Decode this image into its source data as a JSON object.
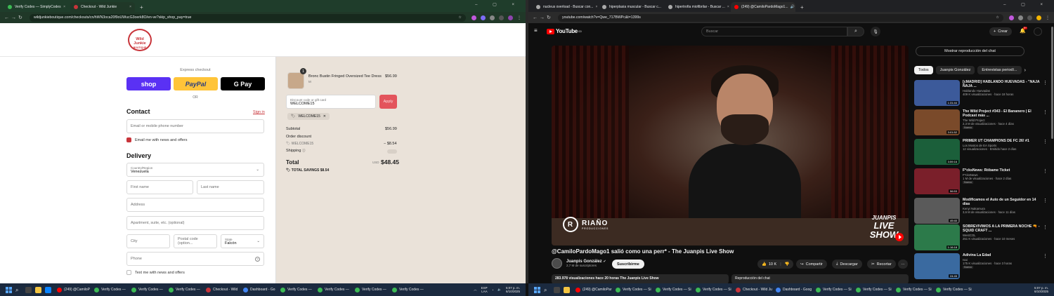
{
  "left_browser": {
    "tabs": [
      {
        "title": "Verify Codes — SimplyCodes",
        "color": "#3cba54",
        "active": false
      },
      {
        "title": "Checkout - Wild Junkie",
        "color": "#c8343a",
        "active": true
      }
    ],
    "url": "wildjunkieboutique.com/checkouts/cn/hWN3oca20f9oUWucG3oerk8O/en-ve?skip_shop_pay=true"
  },
  "checkout": {
    "logo_text": "Wild Junkie",
    "logo_sub": "BOUTIQUE",
    "express_label": "Express checkout",
    "shop_label": "shop",
    "paypal_label": "PayPal",
    "gpay_label": "G Pay",
    "or_label": "OR",
    "contact_heading": "Contact",
    "sign_in": "Sign in",
    "email_placeholder": "Email or mobile phone number",
    "email_news_label": "Email me with news and offers",
    "delivery_heading": "Delivery",
    "country_label": "Country/Region",
    "country_value": "Venezuela",
    "first_name": "First name",
    "last_name": "Last name",
    "address": "Address",
    "apartment": "Apartment, suite, etc. (optional)",
    "city": "City",
    "postal": "Postal code (option...",
    "state_label": "State",
    "state_value": "Falcón",
    "phone": "Phone",
    "text_news_label": "Text me with news and offers"
  },
  "summary": {
    "qty": "1",
    "product_name": "Bronc Bustin Fringed Oversized Tee Dress",
    "variant": "M",
    "product_price": "$56.99",
    "discount_label": "Discount code or gift card",
    "discount_value": "WELCOME15",
    "apply": "Apply",
    "chip_code": "WELCOME15",
    "subtotal_label": "Subtotal",
    "subtotal_value": "$56.99",
    "order_discount_label": "Order discount",
    "discount_code": "WELCOME15",
    "discount_amount": "− $8.54",
    "shipping_label": "Shipping",
    "total_label": "Total",
    "currency": "USD",
    "total_value": "$48.45",
    "savings_label": "TOTAL SAVINGS",
    "savings_value": "$8.54"
  },
  "right_browser": {
    "tabs": [
      {
        "title": "nucleus overload - Buscar con...",
        "color": "#aaaaaa",
        "active": false
      },
      {
        "title": "hiperplasia muscular - Buscar c...",
        "color": "#aaaaaa",
        "active": false
      },
      {
        "title": "hipertrofia miofibrilar - Buscar ...",
        "color": "#aaaaaa",
        "active": false
      },
      {
        "title": "(249) @CamiloPardoMago1...",
        "color": "#ff0000",
        "active": true
      }
    ],
    "url": "youtube.com/watch?v=Qwe_717BWPc&t=1399s"
  },
  "youtube": {
    "logo": "YouTube",
    "region": "CO",
    "search_placeholder": "Buscar",
    "create": "Crear",
    "notif_count": "9+",
    "video_title": "@CamiloPardoMago1 salió como una perr* - The Juanpis Live Show",
    "watermark_left": "RIAÑO",
    "watermark_left_sub": "PRODUCCIONES",
    "watermark_right_top": "JUANPIS",
    "watermark_right_bottom": "LIVE SHOW",
    "channel_name": "Juanpis González",
    "subscribers": "2,7 M de suscriptores",
    "subscribe": "Suscribirme",
    "likes": "10 K",
    "share": "Compartir",
    "download": "Descargar",
    "clip": "Recortar",
    "more": "···",
    "views_meta": "283.978 visualizaciones  hace 20 horas  The Juanpis Live Show",
    "chat_replay": "Reproducción del chat",
    "show_chat": "Mostrar reproducción del chat",
    "chips": [
      "Todos",
      "Juanpis González",
      "Entrevistas periodí..."
    ],
    "recommendations": [
      {
        "title": "[cMADRID] HABLANDO HUEVADAS - \"ÑAJA ÑAJA ...",
        "channel": "Hablando Huevadas",
        "meta": "409 K visualizaciones · hace 18 horas",
        "duration": "1:31:44",
        "new": "",
        "thumb": "#3c5a9a"
      },
      {
        "title": "The Wild Project #343 - El Bananero | El Podcast más ...",
        "channel": "The Wild Project",
        "meta": "2,3 M de visualizaciones · hace 4 días",
        "duration": "3:01:52",
        "new": "Nuevo",
        "thumb": "#7a4a2a"
      },
      {
        "title": "PRIMER UT CHAMPIONS DE FC 26! #1",
        "channel": "Los Mostos de EA Sports",
        "meta": "12 visualizaciones · Emitido hace 2 días",
        "duration": "3:59:16",
        "new": "",
        "thumb": "#1b5f3a"
      },
      {
        "title": "F*cksNews: Róbame Ticket",
        "channel": "F*cksNews",
        "meta": "1 M de visualizaciones · hace 2 días",
        "duration": "56:53",
        "new": "Nuevo",
        "thumb": "#7a1f2a"
      },
      {
        "title": "Modificamos el Auto de un Seguidor en 14 días",
        "channel": "Kenyi Nakamura",
        "meta": "3,6 M de visualizaciones · hace 11 días",
        "duration": "49:40",
        "new": "",
        "thumb": "#5a5a5a"
      },
      {
        "title": "SOBREVIVIMOS A LA PRIMERA NOCHE 🔫 - SQUID CRAFT ...",
        "channel": "WestCOL",
        "meta": "251 K visualizaciones · hace 10 meses",
        "duration": "1:16:18",
        "new": "",
        "thumb": "#2c7a4a"
      },
      {
        "title": "Adivina La Edad",
        "channel": "Isai",
        "meta": "175 K visualizaciones · hace 3 horas",
        "duration": "24:45",
        "new": "Nuevo",
        "thumb": "#3a6aa0"
      }
    ]
  },
  "taskbar_left": {
    "tasks": [
      {
        "label": "(249) @CamiloP",
        "color": "#ff0000"
      },
      {
        "label": "Verify Codes —",
        "color": "#3cba54"
      },
      {
        "label": "Verify Codes —",
        "color": "#3cba54"
      },
      {
        "label": "Verify Codes —",
        "color": "#3cba54"
      },
      {
        "label": "Checkout - Wild",
        "color": "#c8343a"
      },
      {
        "label": "Dashboard - Go",
        "color": "#4285f4"
      },
      {
        "label": "Verify Codes —",
        "color": "#3cba54"
      },
      {
        "label": "Verify Codes —",
        "color": "#3cba54"
      },
      {
        "label": "Verify Codes —",
        "color": "#3cba54"
      },
      {
        "label": "Verify Codes —",
        "color": "#3cba54"
      }
    ],
    "lang": "ESP",
    "lang2": "LAA",
    "time": "5:07 p. m.",
    "date": "6/10/2025"
  },
  "taskbar_right": {
    "tasks": [
      {
        "label": "(249) @CamiloPar",
        "color": "#ff0000"
      },
      {
        "label": "Verify Codes — Si",
        "color": "#3cba54"
      },
      {
        "label": "Verify Codes — Si",
        "color": "#3cba54"
      },
      {
        "label": "Verify Codes — Si",
        "color": "#3cba54"
      },
      {
        "label": "Checkout - Wild Ju",
        "color": "#c8343a"
      },
      {
        "label": "Dashboard - Goog",
        "color": "#4285f4"
      },
      {
        "label": "Verify Codes — Si",
        "color": "#3cba54"
      },
      {
        "label": "Verify Codes — Si",
        "color": "#3cba54"
      },
      {
        "label": "Verify Codes — Si",
        "color": "#3cba54"
      },
      {
        "label": "Verify Codes — Si",
        "color": "#3cba54"
      }
    ],
    "time": "5:07 p. m.",
    "date": "6/10/2025"
  }
}
